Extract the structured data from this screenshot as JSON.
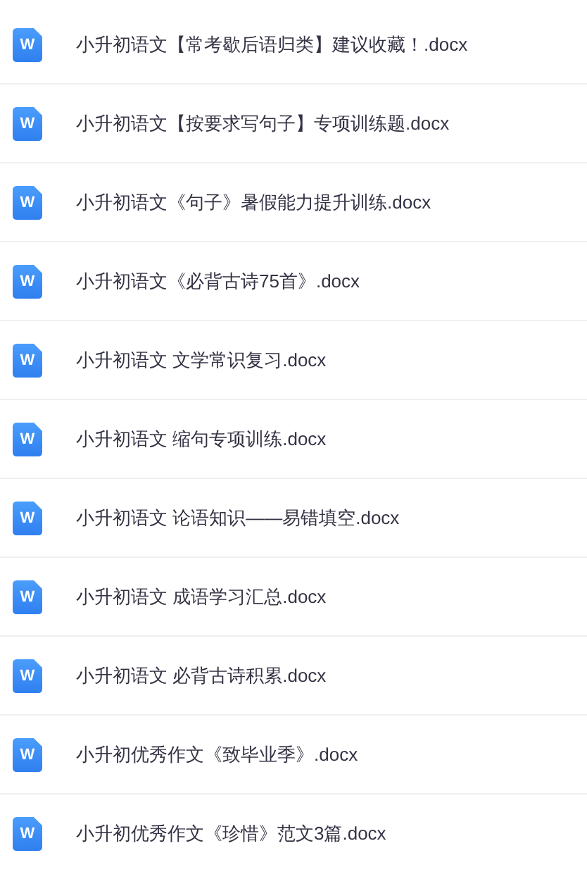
{
  "files": [
    {
      "icon": "W",
      "name": "小升初语文【常考歇后语归类】建议收藏！.docx"
    },
    {
      "icon": "W",
      "name": "小升初语文【按要求写句子】专项训练题.docx"
    },
    {
      "icon": "W",
      "name": "小升初语文《句子》暑假能力提升训练.docx"
    },
    {
      "icon": "W",
      "name": "小升初语文《必背古诗75首》.docx"
    },
    {
      "icon": "W",
      "name": "小升初语文 文学常识复习.docx"
    },
    {
      "icon": "W",
      "name": "小升初语文 缩句专项训练.docx"
    },
    {
      "icon": "W",
      "name": "小升初语文 论语知识——易错填空.docx"
    },
    {
      "icon": "W",
      "name": "小升初语文 成语学习汇总.docx"
    },
    {
      "icon": "W",
      "name": "小升初语文 必背古诗积累.docx"
    },
    {
      "icon": "W",
      "name": "小升初优秀作文《致毕业季》.docx"
    },
    {
      "icon": "W",
      "name": "小升初优秀作文《珍惜》范文3篇.docx"
    }
  ]
}
